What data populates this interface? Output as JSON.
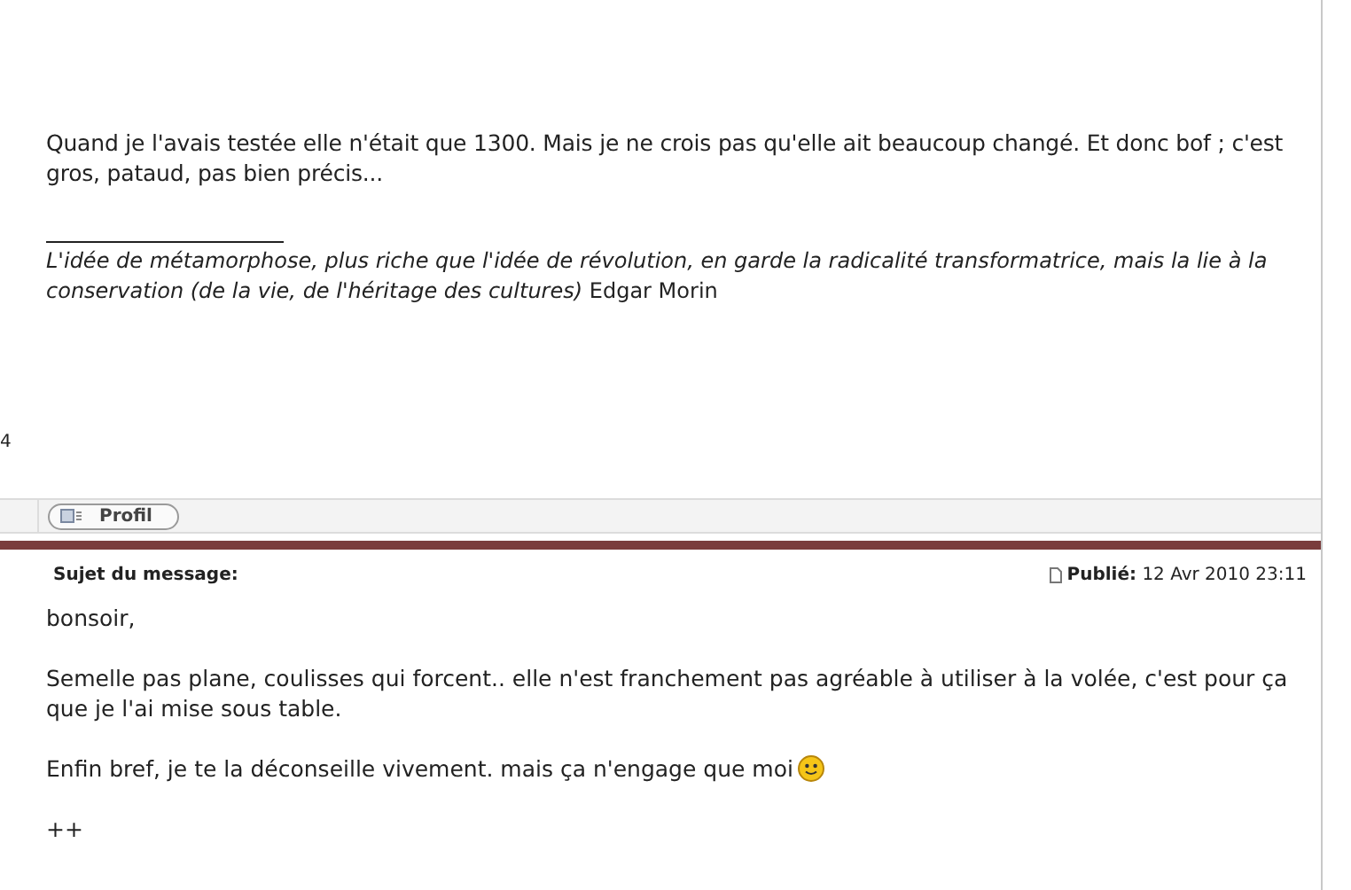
{
  "previous_post": {
    "paragraphs": [
      "Quand je l'avais testée elle n'était que 1300. Mais je ne crois pas qu'elle ait beaucoup changé. Et donc bof ; c'est gros, pataud, pas bien précis..."
    ],
    "signature": {
      "quote": "L'idée de métamorphose, plus riche que l'idée de révolution, en garde la radicalité transformatrice, mais la lie à la conservation (de la vie, de l'héritage des cultures)",
      "author": "Edgar Morin"
    },
    "side_text": "4",
    "profile_button": "Profil"
  },
  "post": {
    "subject_label": "Sujet du message:",
    "published_label": "Publié:",
    "date": "12 Avr 2010 23:11",
    "paragraphs": [
      {
        "text": "bonsoir,",
        "smiley": false
      },
      {
        "text": "Semelle pas plane, coulisses qui forcent.. elle n'est franchement pas agréable à utiliser à la volée, c'est pour ça que je l'ai mise sous table.",
        "smiley": false
      },
      {
        "text": "Enfin bref, je te la déconseille vivement. mais ça n'engage que moi",
        "smiley": true
      },
      {
        "text": "++",
        "smiley": false
      }
    ]
  }
}
